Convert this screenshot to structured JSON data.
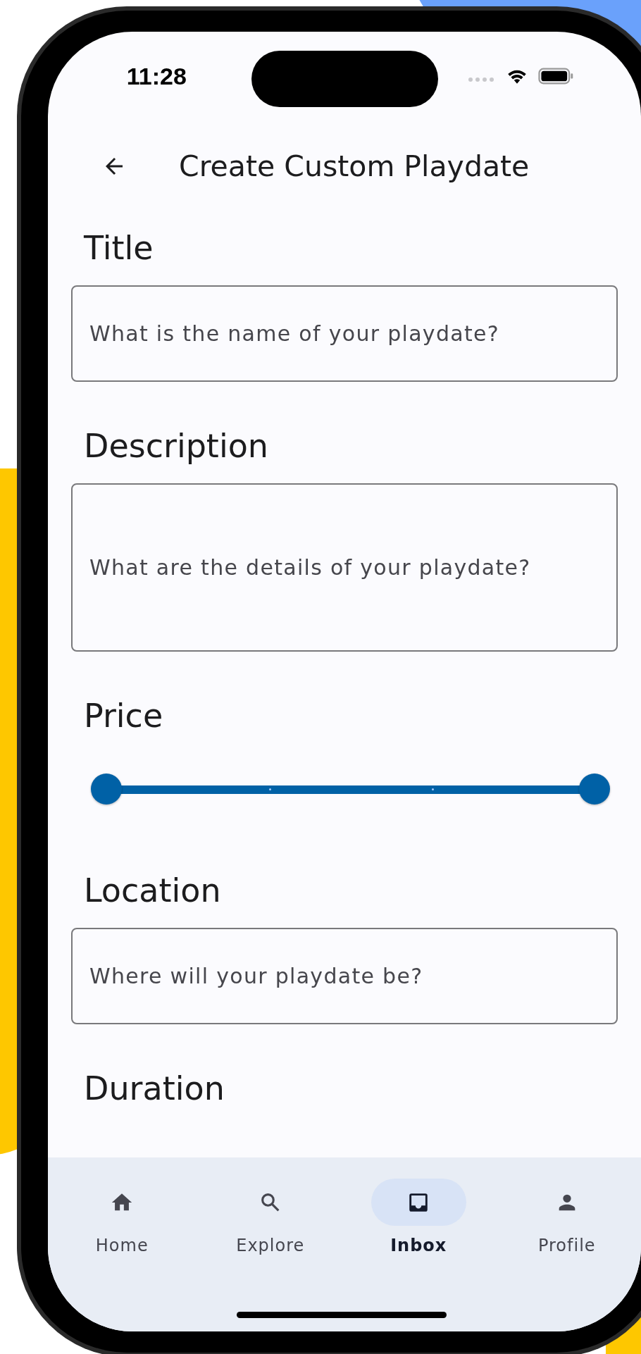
{
  "status_bar": {
    "time": "11:28"
  },
  "header": {
    "title": "Create Custom Playdate"
  },
  "form": [
    {
      "kind": "field",
      "label": "Title",
      "placeholder": "What is the name of your playdate?"
    },
    {
      "kind": "textarea",
      "label": "Description",
      "placeholder": "What are the details of your playdate?"
    },
    {
      "kind": "range",
      "label": "Price",
      "thumbs": [
        {
          "level": 0
        },
        {
          "level": 1
        }
      ]
    },
    {
      "kind": "field",
      "label": "Location",
      "placeholder": "Where will your playdate be?"
    },
    {
      "kind": "heading",
      "label": "Duration"
    }
  ],
  "bottom_nav": [
    {
      "label": "Home",
      "selected": false
    },
    {
      "label": "Explore",
      "selected": false
    },
    {
      "label": "Inbox",
      "selected": true
    },
    {
      "label": "Profile",
      "selected": false
    }
  ]
}
